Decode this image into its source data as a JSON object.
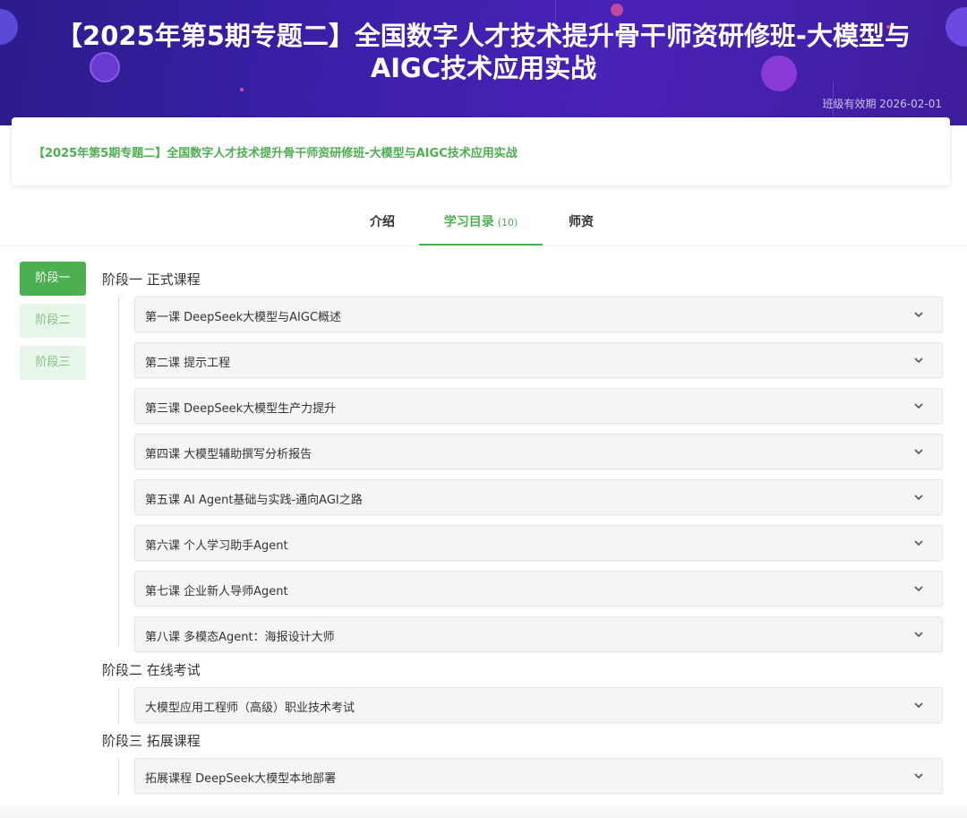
{
  "banner": {
    "title": "【2025年第5期专题二】全国数字人才技术提升骨干师资研修班-大模型与AIGC技术应用实战",
    "validity": "班级有效期 2026-02-01"
  },
  "course_card": {
    "title": "【2025年第5期专题二】全国数字人才技术提升骨干师资研修班-大模型与AIGC技术应用实战"
  },
  "tabs": [
    {
      "label": "介绍",
      "count": ""
    },
    {
      "label": "学习目录",
      "count": "(10)"
    },
    {
      "label": "师资",
      "count": ""
    }
  ],
  "stages": [
    {
      "label": "阶段一",
      "active": true
    },
    {
      "label": "阶段二",
      "active": false
    },
    {
      "label": "阶段三",
      "active": false
    }
  ],
  "sections": [
    {
      "title": "阶段一  正式课程",
      "lessons": [
        "第一课 DeepSeek大模型与AIGC概述",
        "第二课 提示工程",
        "第三课 DeepSeek大模型生产力提升",
        "第四课 大模型辅助撰写分析报告",
        "第五课 AI Agent基础与实践-通向AGI之路",
        "第六课 个人学习助手Agent",
        "第七课 企业新人导师Agent",
        "第八课 多模态Agent：海报设计大师"
      ]
    },
    {
      "title": "阶段二  在线考试",
      "lessons": [
        "大模型应用工程师（高级）职业技术考试"
      ]
    },
    {
      "title": "阶段三  拓展课程",
      "lessons": [
        "拓展课程 DeepSeek大模型本地部署"
      ]
    }
  ],
  "colors": {
    "accent": "#4caf50",
    "banner": "#3a1fa8"
  },
  "icons": {
    "lesson_toggle": "chevron-down-icon"
  }
}
